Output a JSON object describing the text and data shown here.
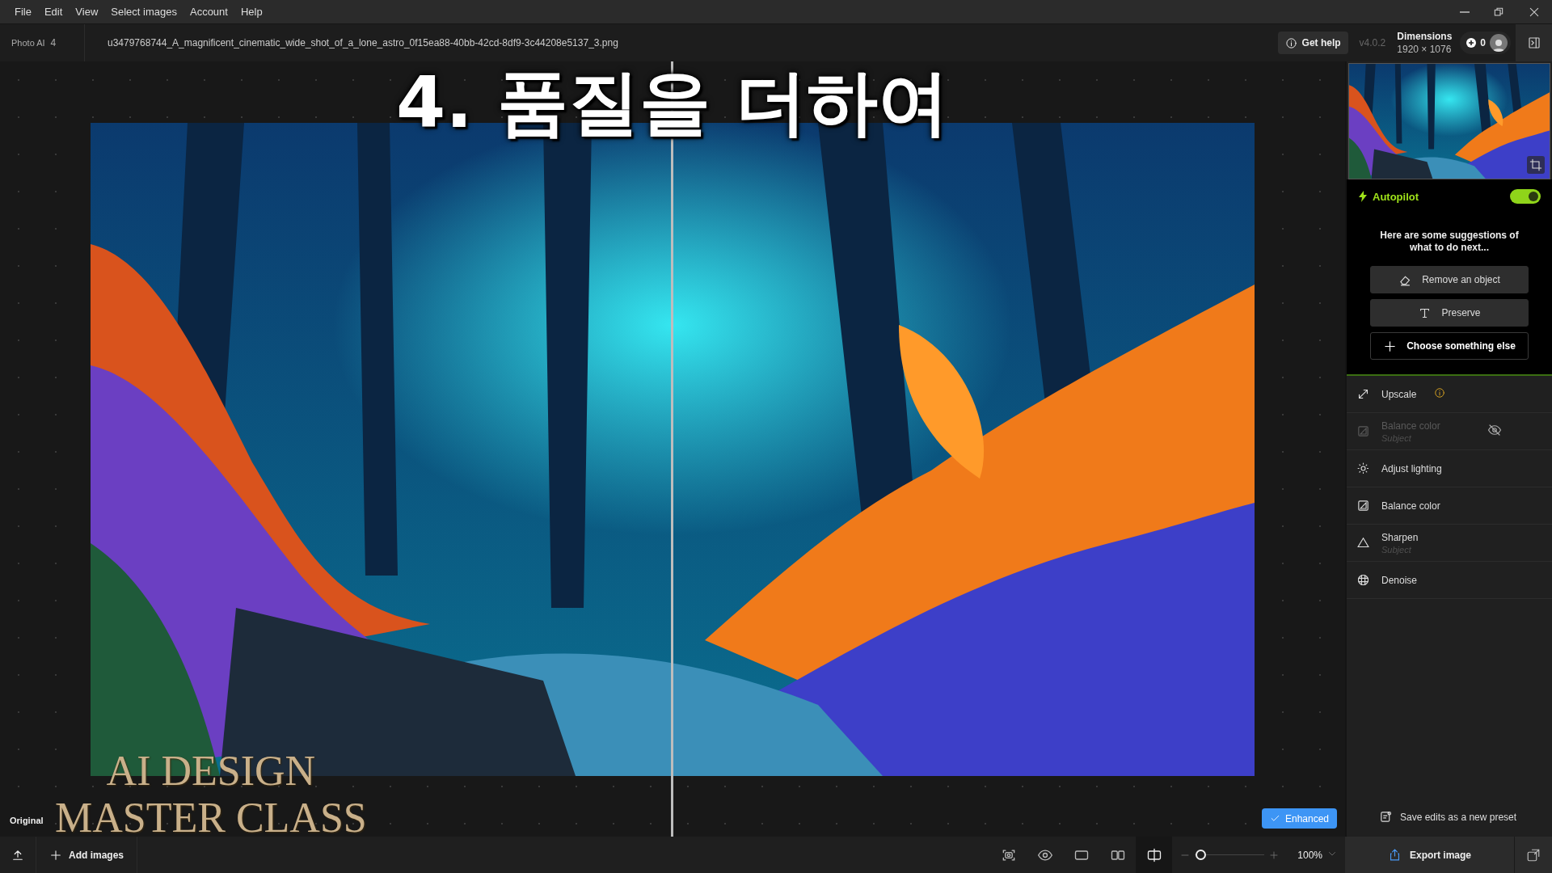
{
  "menu": [
    "File",
    "Edit",
    "View",
    "Select images",
    "Account",
    "Help"
  ],
  "header": {
    "app_name": "Photo AI",
    "image_count": "4",
    "filename": "u3479768744_A_magnificent_cinematic_wide_shot_of_a_lone_astro_0f15ea88-40bb-42cd-8df9-3c44208e5137_3.png",
    "help_button": "Get help",
    "version": "v4.0.2",
    "dimensions_label": "Dimensions",
    "dimensions_value": "1920 × 1076",
    "credits": "0"
  },
  "canvas": {
    "title_overlay": "4. 품질을 더하여",
    "brand_overlay": [
      "AI DESIGN",
      "MASTER CLASS"
    ],
    "original_label": "Original",
    "enhanced_button": "Enhanced"
  },
  "autopilot": {
    "label": "Autopilot",
    "on": true,
    "message": "Here are some suggestions of what to do next...",
    "suggestions": [
      {
        "kind": "erase",
        "label": "Remove an object"
      },
      {
        "kind": "text",
        "label": "Preserve"
      },
      {
        "kind": "add",
        "label": "Choose something else"
      }
    ]
  },
  "tools": [
    {
      "kind": "upscale",
      "label": "Upscale",
      "info": true,
      "disabled": false,
      "hidden": false
    },
    {
      "kind": "balance",
      "label": "Balance color",
      "sublabel": "Subject",
      "info": false,
      "disabled": true,
      "hidden": true
    },
    {
      "kind": "lighting",
      "label": "Adjust lighting",
      "info": false,
      "disabled": false,
      "hidden": false
    },
    {
      "kind": "balance",
      "label": "Balance color",
      "info": false,
      "disabled": false,
      "hidden": false
    },
    {
      "kind": "sharpen",
      "label": "Sharpen",
      "sublabel": "Subject",
      "info": false,
      "disabled": false,
      "hidden": false
    },
    {
      "kind": "denoise",
      "label": "Denoise",
      "info": false,
      "disabled": false,
      "hidden": false
    }
  ],
  "save_preset": "Save edits as a new preset",
  "bottom": {
    "add_images": "Add images",
    "view_modes": [
      {
        "kind": "focus",
        "selected": false
      },
      {
        "kind": "eye",
        "selected": false
      },
      {
        "kind": "single",
        "selected": false
      },
      {
        "kind": "side",
        "selected": false
      },
      {
        "kind": "split",
        "selected": true
      }
    ],
    "zoom": {
      "level": 0.08,
      "reading": "100%"
    },
    "export_button": "Export image"
  }
}
